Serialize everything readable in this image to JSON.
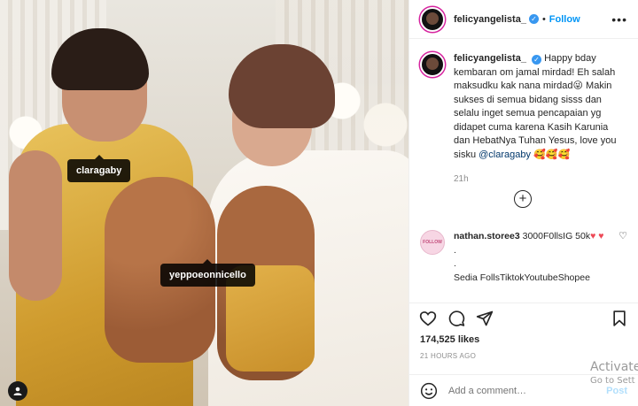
{
  "photo": {
    "tags": [
      "claragaby",
      "yeppoeonnicello"
    ]
  },
  "header": {
    "username": "felicyangelista_",
    "separator": "•",
    "follow_label": "Follow",
    "more_label": "•••"
  },
  "caption": {
    "username": "felicyangelista_",
    "text": "Happy bday kembaran om jamal mirdad! Eh salah maksudku kak nana mirdad😜 Makin sukses di semua bidang sisss dan selalu inget semua pencapaian yg didapet cuma karena Kasih Karunia dan HebatNya Tuhan Yesus, love you sisku",
    "mention": "@claragaby",
    "emojis": "🥰🥰🥰",
    "time": "21h"
  },
  "load_more": "+",
  "comment": {
    "avatar_text": "FOLLOW",
    "username": "nathan.storee3",
    "text_1": "3000F0llsIG 50k",
    "heart_1": "♥",
    "heart_2": "♥",
    "line_2": ".",
    "line_3": ".",
    "line_4": "Sedia FollsTiktokYoutubeShopee",
    "like_icon": "♡"
  },
  "stats": {
    "likes": "174,525 likes",
    "posted": "21 HOURS AGO"
  },
  "add_comment": {
    "placeholder": "Add a comment…",
    "post_label": "Post"
  },
  "watermark": {
    "line1": "Activate",
    "line2": "Go to Sett"
  },
  "icons": {
    "like": "heart-outline-icon",
    "comment": "comment-bubble-icon",
    "share": "paper-plane-icon",
    "save": "bookmark-icon",
    "emoji": "smiley-icon",
    "user_tag": "user-tag-icon"
  },
  "colors": {
    "accent_blue": "#0095f6",
    "verified_blue": "#3897f0",
    "heart_red": "#ed4956",
    "post_disabled": "#b2dffc"
  }
}
